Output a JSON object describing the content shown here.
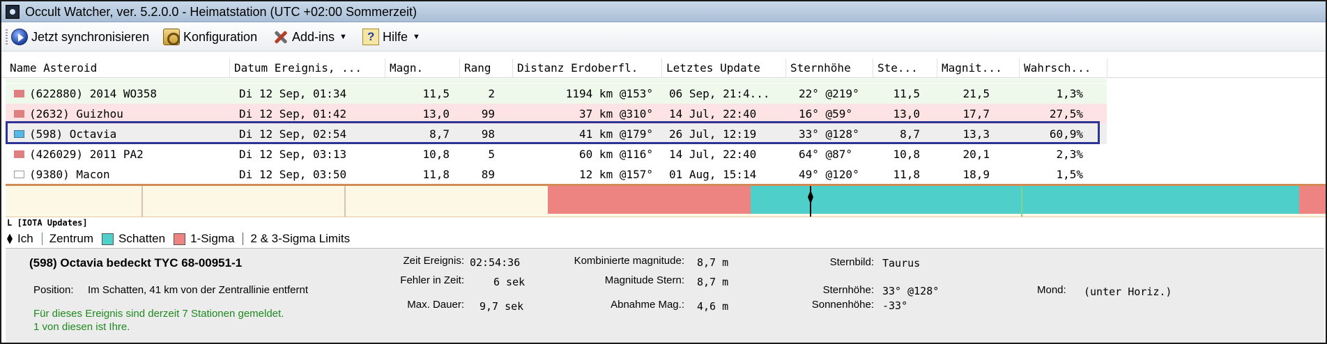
{
  "window": {
    "title": "Occult Watcher, ver. 5.2.0.0 - Heimatstation (UTC +02:00 Sommerzeit)"
  },
  "toolbar": {
    "sync_label": "Jetzt synchronisieren",
    "config_label": "Konfiguration",
    "addins_label": "Add-ins",
    "help_label": "Hilfe"
  },
  "table": {
    "columns": [
      "Name Asteroid",
      "Datum Ereignis, ...",
      "Magn.",
      "Rang",
      "Distanz Erdoberfl.",
      "Letztes Update",
      "Sternhöhe",
      "Ste...",
      "Magnit...",
      "Wahrsch..."
    ],
    "rows": [
      {
        "name": "(622880) 2014 WO358",
        "date": "Di 12 Sep, 01:34",
        "magn": "11,5",
        "rank": "2",
        "distance": "1194 km @153°",
        "updated": "06 Sep, 21:4...",
        "altitude": "22° @219°",
        "star_mag": "11,5",
        "mag_drop": "21,5",
        "probability": "1,3%",
        "bg": "#eef9ec",
        "marker": "#e07f7f"
      },
      {
        "name": "(2632) Guizhou",
        "date": "Di 12 Sep, 01:42",
        "magn": "13,0",
        "rank": "99",
        "distance": "37 km @310°",
        "updated": "14 Jul, 22:40",
        "altitude": "16° @59°",
        "star_mag": "13,0",
        "mag_drop": "17,7",
        "probability": "27,5%",
        "bg": "#fde3e3",
        "marker": "#e07f7f"
      },
      {
        "name": "(598) Octavia",
        "date": "Di 12 Sep, 02:54",
        "magn": "8,7",
        "rank": "98",
        "distance": "41 km @179°",
        "updated": "26 Jul, 12:19",
        "altitude": "33° @128°",
        "star_mag": "8,7",
        "mag_drop": "13,3",
        "probability": "60,9%",
        "bg": "#eeeeee",
        "marker": "#55b8e6"
      },
      {
        "name": "(426029) 2011 PA2",
        "date": "Di 12 Sep, 03:13",
        "magn": "10,8",
        "rank": "5",
        "distance": "60 km @116°",
        "updated": "14 Jul, 22:40",
        "altitude": "64° @87°",
        "star_mag": "10,8",
        "mag_drop": "20,1",
        "probability": "2,3%",
        "bg": "#ffffff",
        "marker": "#e07f7f"
      },
      {
        "name": "(9380) Macon",
        "date": "Di 12 Sep, 03:50",
        "magn": "11,8",
        "rank": "89",
        "distance": "12 km @157°",
        "updated": "01 Aug, 15:14",
        "altitude": "49° @120°",
        "star_mag": "11,8",
        "mag_drop": "18,9",
        "probability": "1,5%",
        "bg": "#ffffff",
        "marker": "#ffffff"
      }
    ]
  },
  "timeline": {
    "label": "L [IOTA Updates]",
    "colors": {
      "background": "#fdf7e6",
      "one_sigma": "#ee8482",
      "shadow": "#4ecfca",
      "edge": "#d38b55"
    }
  },
  "legend": {
    "me": "Ich",
    "center": "Zentrum",
    "shadow": "Schatten",
    "one_sigma": "1-Sigma",
    "limits": "2 & 3-Sigma Limits"
  },
  "details": {
    "title": "(598) Octavia bedeckt TYC 68-00951-1",
    "position_label": "Position:",
    "position_value": "Im Schatten, 41 km von der Zentrallinie entfernt",
    "stations_line1": "Für dieses Ereignis sind derzeit 7 Stationen gemeldet.",
    "stations_line2": "1 von diesen ist Ihre.",
    "event_time_label": "Zeit Ereignis:",
    "event_time_value": "02:54:36",
    "time_error_label": "Fehler in Zeit:",
    "time_error_value": "6 sek",
    "max_duration_label": "Max. Dauer:",
    "max_duration_value": "9,7 sek",
    "combined_mag_label": "Kombinierte magnitude:",
    "combined_mag_value": "8,7 m",
    "star_mag_label": "Magnitude Stern:",
    "star_mag_value": "8,7 m",
    "mag_drop_label": "Abnahme Mag.:",
    "mag_drop_value": "4,6 m",
    "constellation_label": "Sternbild:",
    "constellation_value": "Taurus",
    "star_alt_label": "Sternhöhe:",
    "star_alt_value": "33° @128°",
    "sun_alt_label": "Sonnenhöhe:",
    "sun_alt_value": "-33°",
    "moon_label": "Mond:",
    "moon_value": "(unter Horiz.)"
  }
}
